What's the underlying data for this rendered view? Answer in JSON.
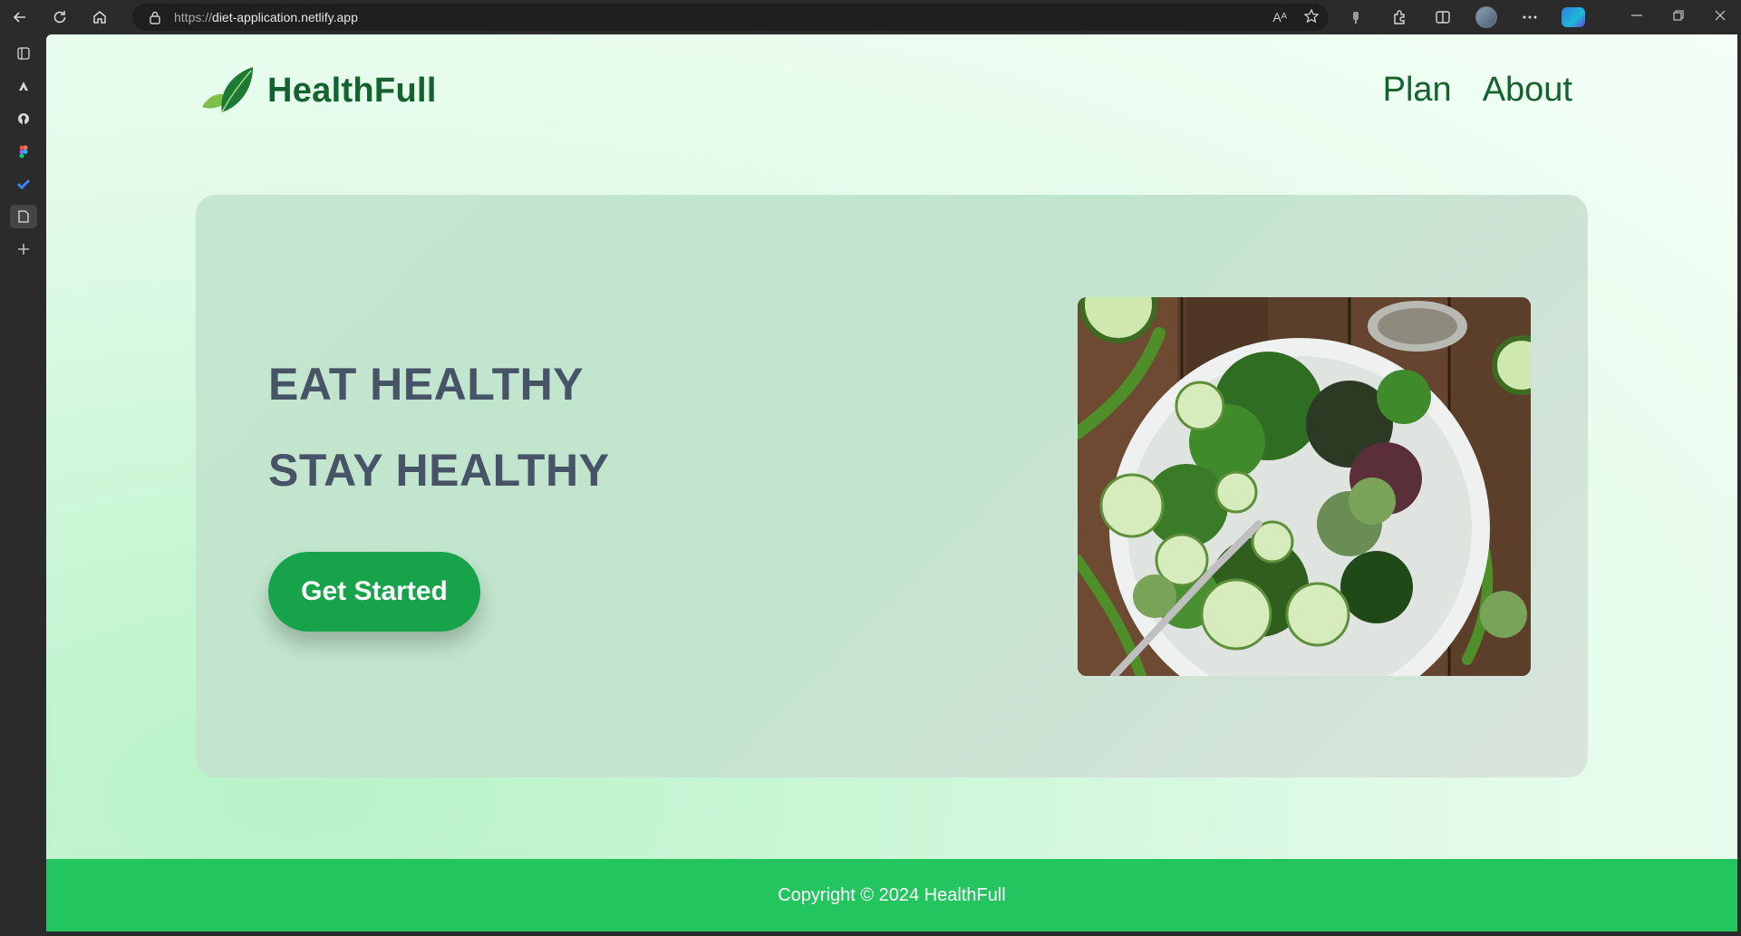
{
  "browser": {
    "url_protocol": "https://",
    "url_host": "diet-application.netlify.app",
    "icons": [
      "back-icon",
      "refresh-icon",
      "home-icon",
      "lock-icon",
      "read-aloud-icon",
      "favorite-star-icon",
      "extensions-icon",
      "split-screen-icon",
      "profile-avatar",
      "more-icon",
      "copilot-icon"
    ],
    "read_aloud_glyph": "Aᴬ"
  },
  "sidebar": {
    "icons": [
      "tab-actions-icon",
      "adobe-icon",
      "github-icon",
      "figma-icon",
      "todo-icon",
      "page-icon",
      "add-icon"
    ]
  },
  "site": {
    "brand": "HealthFull",
    "nav": [
      {
        "label": "Plan"
      },
      {
        "label": "About"
      }
    ],
    "hero": {
      "line1": "EAT HEALTHY",
      "line2": "STAY HEALTHY",
      "cta": "Get Started",
      "image_alt": "salad-plate-photo"
    },
    "footer": "Copyright © 2024 HealthFull"
  },
  "colors": {
    "brand_green": "#14632f",
    "button_green": "#16a34a",
    "footer_green": "#22c55e",
    "hero_text": "#475366"
  }
}
